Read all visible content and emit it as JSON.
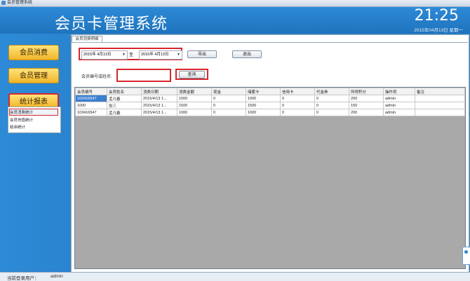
{
  "window": {
    "title": "会员管理系统"
  },
  "header": {
    "app_title": "会员卡管理系统",
    "time": "21:25",
    "date": "2015年04月13日 星期一"
  },
  "sidebar": {
    "buttons": [
      "会员消费",
      "会员管理",
      "统计报表"
    ],
    "submenu": [
      "会员消费统计",
      "会员充值统计",
      "结余统计"
    ]
  },
  "tab": {
    "label": "会员消费明细"
  },
  "filter": {
    "start_date": "2015年 4月13日",
    "to_label": "至",
    "end_date": "2015年 4月13日",
    "export_label": "导出",
    "exit_label": "退出",
    "search_label": "会员编号或姓名:",
    "search_value": "",
    "query_label": "查询"
  },
  "table": {
    "columns": [
      "会员编号",
      "会员姓名",
      "消费日期",
      "消费金额",
      "现金",
      "储蓄卡",
      "信用卡",
      "代金券",
      "所得积分",
      "操作员",
      "备注"
    ],
    "rows": [
      [
        "103416547",
        "孟凡春",
        "2015/4/13 1...",
        "1000",
        "0",
        "1000",
        "0",
        "0",
        "200",
        "admin",
        ""
      ],
      [
        "1000",
        "张三",
        "2015/4/13 1...",
        "1500",
        "0",
        "1500",
        "0",
        "0",
        "150",
        "admin",
        ""
      ],
      [
        "103416547",
        "孟凡春",
        "2015/4/13 1...",
        "1000",
        "0",
        "1000",
        "0",
        "0",
        "200",
        "admin",
        ""
      ]
    ]
  },
  "status": {
    "label": "当前登录用户：",
    "user": "admin"
  }
}
